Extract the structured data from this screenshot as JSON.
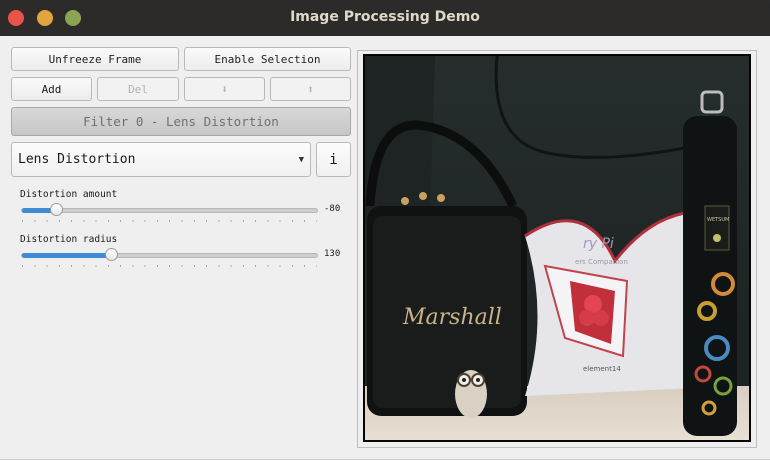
{
  "window": {
    "title": "Image Processing Demo"
  },
  "toolbar": {
    "unfreeze_label": "Unfreeze Frame",
    "enable_selection_label": "Enable Selection",
    "add_label": "Add",
    "del_label": "Del",
    "move_down_label": "⬇",
    "move_up_label": "⬆"
  },
  "filter": {
    "header": "Filter 0 - Lens Distortion",
    "selected": "Lens Distortion",
    "info_label": "i"
  },
  "sliders": [
    {
      "label": "Distortion amount",
      "value": "-80",
      "fraction": 0.115
    },
    {
      "label": "Distortion radius",
      "value": "130",
      "fraction": 0.3
    }
  ],
  "image": {
    "brand_text": "Marshall",
    "bottle_label": "WETSUM",
    "book_title": "ry Pi",
    "book_subtitle": "ers Companion",
    "book_brand": "element14"
  },
  "colors": {
    "accent": "#3d8bd3",
    "close": "#e8534b",
    "minimize": "#e2a43f",
    "maximize": "#8aa453"
  }
}
